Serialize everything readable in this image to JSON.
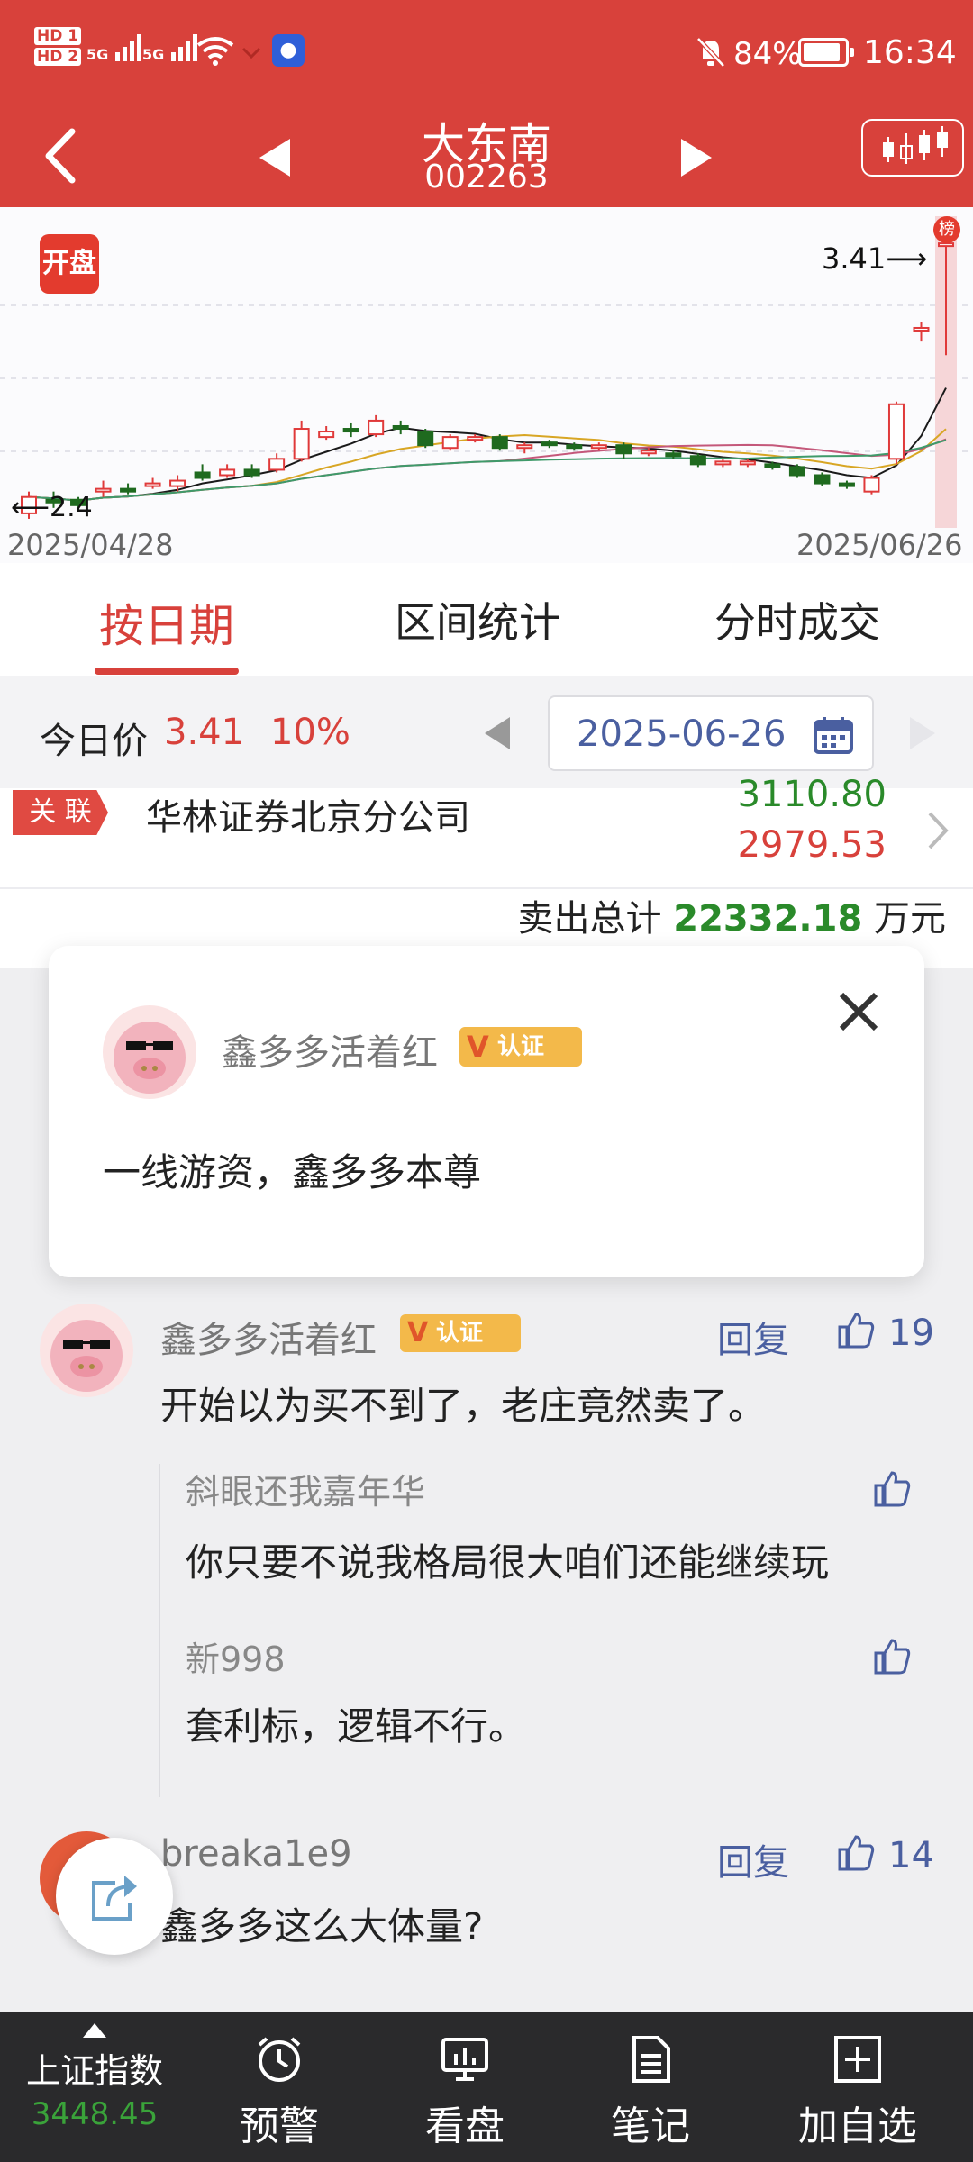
{
  "status": {
    "battery_pct": "84%",
    "time": "16:34",
    "sim1": "HD 1",
    "sim2": "HD 2",
    "net1": "5G",
    "net2": "5G"
  },
  "nav": {
    "stock_name": "大东南",
    "stock_code": "002263"
  },
  "chart": {
    "open_label": "开盘",
    "rank_label": "榜",
    "high_label": "3.41",
    "low_label": "2.4",
    "start_date": "2025/04/28",
    "end_date": "2025/06/26"
  },
  "chart_data": {
    "type": "candlestick",
    "x_range": [
      "2025/04/28",
      "2025/06/26"
    ],
    "high": 3.41,
    "low": 2.4,
    "candles": [
      {
        "o": 2.42,
        "c": 2.48,
        "h": 2.5,
        "l": 2.4,
        "up": true
      },
      {
        "o": 2.46,
        "c": 2.47,
        "h": 2.5,
        "l": 2.44,
        "up": false
      },
      {
        "o": 2.47,
        "c": 2.45,
        "h": 2.48,
        "l": 2.43,
        "up": false
      },
      {
        "o": 2.5,
        "c": 2.51,
        "h": 2.54,
        "l": 2.48,
        "up": true
      },
      {
        "o": 2.51,
        "c": 2.5,
        "h": 2.53,
        "l": 2.49,
        "up": false
      },
      {
        "o": 2.52,
        "c": 2.53,
        "h": 2.55,
        "l": 2.51,
        "up": true
      },
      {
        "o": 2.52,
        "c": 2.54,
        "h": 2.56,
        "l": 2.5,
        "up": true
      },
      {
        "o": 2.55,
        "c": 2.57,
        "h": 2.6,
        "l": 2.54,
        "up": false
      },
      {
        "o": 2.56,
        "c": 2.58,
        "h": 2.6,
        "l": 2.55,
        "up": true
      },
      {
        "o": 2.56,
        "c": 2.58,
        "h": 2.6,
        "l": 2.55,
        "up": false
      },
      {
        "o": 2.58,
        "c": 2.62,
        "h": 2.64,
        "l": 2.57,
        "up": true
      },
      {
        "o": 2.62,
        "c": 2.73,
        "h": 2.76,
        "l": 2.61,
        "up": true
      },
      {
        "o": 2.7,
        "c": 2.72,
        "h": 2.74,
        "l": 2.69,
        "up": true
      },
      {
        "o": 2.72,
        "c": 2.73,
        "h": 2.75,
        "l": 2.7,
        "up": false
      },
      {
        "o": 2.71,
        "c": 2.76,
        "h": 2.78,
        "l": 2.7,
        "up": true
      },
      {
        "o": 2.74,
        "c": 2.73,
        "h": 2.76,
        "l": 2.71,
        "up": false
      },
      {
        "o": 2.72,
        "c": 2.67,
        "h": 2.73,
        "l": 2.66,
        "up": false
      },
      {
        "o": 2.66,
        "c": 2.7,
        "h": 2.71,
        "l": 2.65,
        "up": true
      },
      {
        "o": 2.69,
        "c": 2.7,
        "h": 2.71,
        "l": 2.68,
        "up": true
      },
      {
        "o": 2.7,
        "c": 2.66,
        "h": 2.71,
        "l": 2.65,
        "up": false
      },
      {
        "o": 2.66,
        "c": 2.67,
        "h": 2.68,
        "l": 2.64,
        "up": true
      },
      {
        "o": 2.68,
        "c": 2.67,
        "h": 2.69,
        "l": 2.66,
        "up": false
      },
      {
        "o": 2.67,
        "c": 2.66,
        "h": 2.68,
        "l": 2.65,
        "up": false
      },
      {
        "o": 2.66,
        "c": 2.67,
        "h": 2.68,
        "l": 2.65,
        "up": true
      },
      {
        "o": 2.67,
        "c": 2.64,
        "h": 2.68,
        "l": 2.62,
        "up": false
      },
      {
        "o": 2.64,
        "c": 2.65,
        "h": 2.66,
        "l": 2.63,
        "up": true
      },
      {
        "o": 2.64,
        "c": 2.63,
        "h": 2.65,
        "l": 2.62,
        "up": false
      },
      {
        "o": 2.63,
        "c": 2.6,
        "h": 2.64,
        "l": 2.59,
        "up": false
      },
      {
        "o": 2.6,
        "c": 2.61,
        "h": 2.62,
        "l": 2.59,
        "up": true
      },
      {
        "o": 2.61,
        "c": 2.6,
        "h": 2.62,
        "l": 2.59,
        "up": true
      },
      {
        "o": 2.6,
        "c": 2.59,
        "h": 2.61,
        "l": 2.58,
        "up": false
      },
      {
        "o": 2.59,
        "c": 2.56,
        "h": 2.6,
        "l": 2.55,
        "up": false
      },
      {
        "o": 2.56,
        "c": 2.53,
        "h": 2.57,
        "l": 2.52,
        "up": false
      },
      {
        "o": 2.53,
        "c": 2.52,
        "h": 2.54,
        "l": 2.51,
        "up": false
      },
      {
        "o": 2.5,
        "c": 2.55,
        "h": 2.56,
        "l": 2.49,
        "up": true
      },
      {
        "o": 2.62,
        "c": 2.82,
        "h": 2.83,
        "l": 2.6,
        "up": true
      },
      {
        "o": 3.1,
        "c": 3.1,
        "h": 3.12,
        "l": 3.05,
        "up": true
      },
      {
        "o": 3.41,
        "c": 3.41,
        "h": 3.41,
        "l": 3.0,
        "up": true
      }
    ]
  },
  "tabs": [
    {
      "label": "按日期"
    },
    {
      "label": "区间统计"
    },
    {
      "label": "分时成交"
    }
  ],
  "datebar": {
    "today_label": "今日价",
    "price": "3.41",
    "change": "10%",
    "date": "2025-06-26"
  },
  "trade": {
    "tag": "关 联",
    "broker": "华林证券北京分公司",
    "buy": "3110.80",
    "sell": "2979.53"
  },
  "summary": {
    "label": "卖出总计",
    "value": "22332.18",
    "unit": "万元"
  },
  "popup": {
    "user": "鑫多多活着红",
    "badge": "认证",
    "bio": "一线游资，鑫多多本尊"
  },
  "comments": [
    {
      "user": "鑫多多活着红",
      "badge": "认证",
      "reply": "回复",
      "likes": "19",
      "text": "开始以为买不到了，老庄竟然卖了。",
      "replies": [
        {
          "user": "斜眼还我嘉年华",
          "text": "你只要不说我格局很大咱们还能继续玩"
        },
        {
          "user": "新998",
          "text": "套利标，逻辑不行。"
        }
      ]
    },
    {
      "user": "breaka1e9",
      "reply": "回复",
      "likes": "14",
      "text": "鑫多多这么大体量?"
    }
  ],
  "bottom_nav": {
    "index_name": "上证指数",
    "index_value": "3448.45",
    "items": [
      {
        "label": "预警"
      },
      {
        "label": "看盘"
      },
      {
        "label": "笔记"
      },
      {
        "label": "加自选"
      }
    ]
  },
  "colors": {
    "red": "#d8413b",
    "green": "#2a7a2a",
    "link": "#4a5fa0"
  }
}
